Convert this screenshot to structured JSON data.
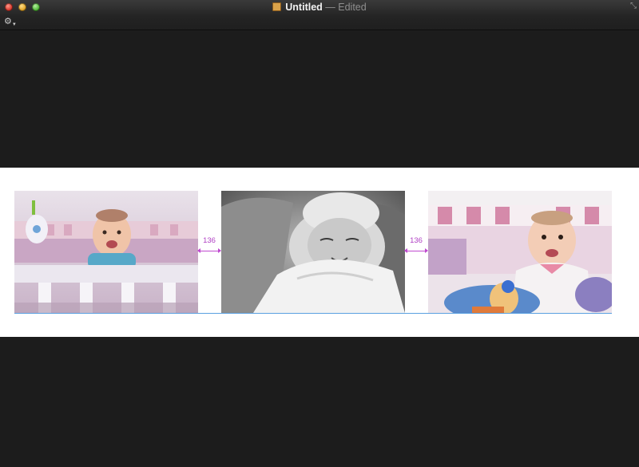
{
  "window": {
    "title": "Untitled",
    "title_separator": "—",
    "status": "Edited",
    "gear_icon": "gear-icon",
    "fullscreen_icon": "fullscreen-icon"
  },
  "canvas": {
    "photos": [
      {
        "name": "photo-baby-crib",
        "description_icon": "image"
      },
      {
        "name": "photo-newborn-bw",
        "description_icon": "image"
      },
      {
        "name": "photo-baby-sitting",
        "description_icon": "image"
      }
    ],
    "spacing_labels": [
      "136",
      "136"
    ]
  },
  "colors": {
    "guide": "#c04ad0",
    "baseline": "#5aa0e0",
    "background": "#1c1c1c"
  }
}
